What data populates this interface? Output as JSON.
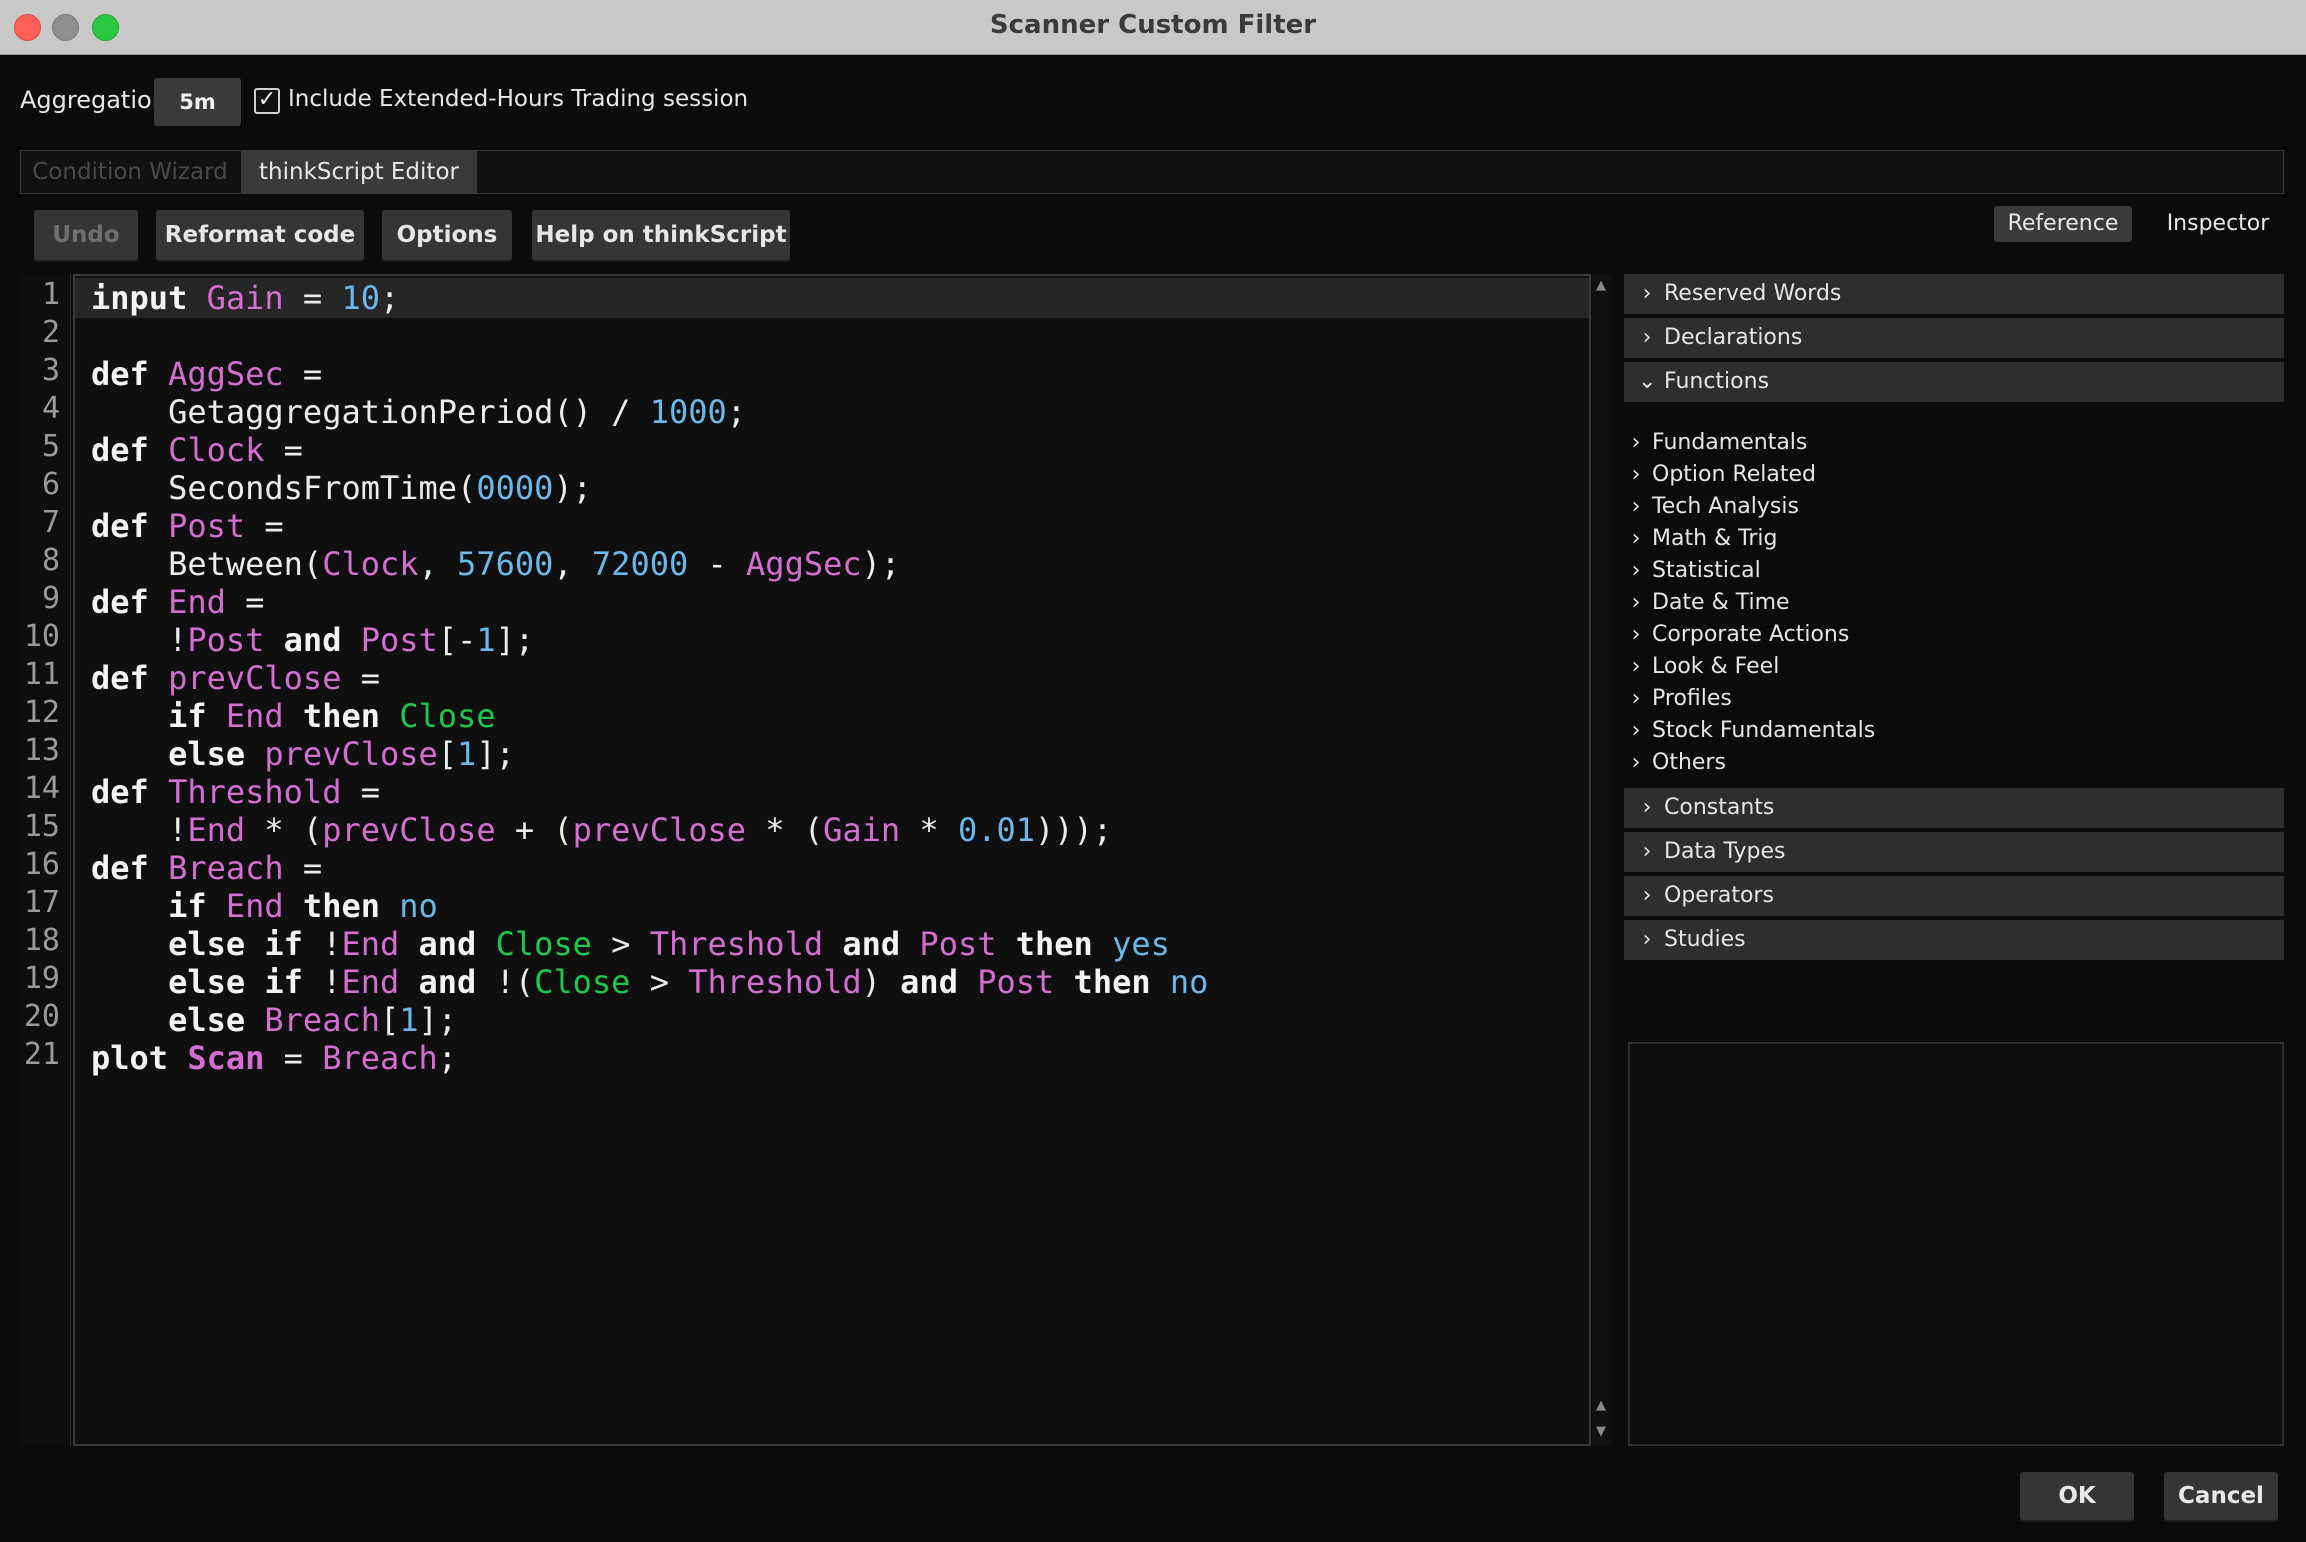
{
  "window": {
    "title": "Scanner Custom Filter"
  },
  "aggregation": {
    "label": "Aggregation:",
    "value": "5m"
  },
  "extended_hours": {
    "label": "Include Extended-Hours Trading session",
    "checked": true,
    "check_glyph": "✓"
  },
  "tabs": [
    {
      "label": "Condition Wizard",
      "active": false
    },
    {
      "label": "thinkScript Editor",
      "active": true
    }
  ],
  "toolbar": {
    "undo_label": "Undo",
    "reformat_label": "Reformat code",
    "options_label": "Options",
    "help_label": "Help on thinkScript"
  },
  "side_tabs": {
    "reference": "Reference",
    "inspector": "Inspector"
  },
  "line_numbers": [
    "1",
    "2",
    "3",
    "4",
    "5",
    "6",
    "7",
    "8",
    "9",
    "10",
    "11",
    "12",
    "13",
    "14",
    "15",
    "16",
    "17",
    "18",
    "19",
    "20",
    "21"
  ],
  "code_lines": [
    [
      {
        "t": "input",
        "c": "kw"
      },
      {
        "t": " "
      },
      {
        "t": "Gain",
        "c": "v"
      },
      {
        "t": " = "
      },
      {
        "t": "10",
        "c": "n"
      },
      {
        "t": ";"
      }
    ],
    [],
    [
      {
        "t": "def",
        "c": "kw"
      },
      {
        "t": " "
      },
      {
        "t": "AggSec",
        "c": "v"
      },
      {
        "t": " ="
      }
    ],
    [
      {
        "t": "    GetaggregationPeriod() / "
      },
      {
        "t": "1000",
        "c": "n"
      },
      {
        "t": ";"
      }
    ],
    [
      {
        "t": "def",
        "c": "kw"
      },
      {
        "t": " "
      },
      {
        "t": "Clock",
        "c": "v"
      },
      {
        "t": " ="
      }
    ],
    [
      {
        "t": "    SecondsFromTime("
      },
      {
        "t": "0000",
        "c": "n"
      },
      {
        "t": ");"
      }
    ],
    [
      {
        "t": "def",
        "c": "kw"
      },
      {
        "t": " "
      },
      {
        "t": "Post",
        "c": "v"
      },
      {
        "t": " ="
      }
    ],
    [
      {
        "t": "    Between("
      },
      {
        "t": "Clock",
        "c": "v"
      },
      {
        "t": ", "
      },
      {
        "t": "57600",
        "c": "n"
      },
      {
        "t": ", "
      },
      {
        "t": "72000",
        "c": "n"
      },
      {
        "t": " - "
      },
      {
        "t": "AggSec",
        "c": "v"
      },
      {
        "t": ");"
      }
    ],
    [
      {
        "t": "def",
        "c": "kw"
      },
      {
        "t": " "
      },
      {
        "t": "End",
        "c": "v"
      },
      {
        "t": " ="
      }
    ],
    [
      {
        "t": "    !"
      },
      {
        "t": "Post",
        "c": "v"
      },
      {
        "t": " "
      },
      {
        "t": "and",
        "c": "kw"
      },
      {
        "t": " "
      },
      {
        "t": "Post",
        "c": "v"
      },
      {
        "t": "[-"
      },
      {
        "t": "1",
        "c": "n"
      },
      {
        "t": "];"
      }
    ],
    [
      {
        "t": "def",
        "c": "kw"
      },
      {
        "t": " "
      },
      {
        "t": "prevClose",
        "c": "v"
      },
      {
        "t": " ="
      }
    ],
    [
      {
        "t": "    "
      },
      {
        "t": "if",
        "c": "kw"
      },
      {
        "t": " "
      },
      {
        "t": "End",
        "c": "v"
      },
      {
        "t": " "
      },
      {
        "t": "then",
        "c": "kw"
      },
      {
        "t": " "
      },
      {
        "t": "Close",
        "c": "g"
      }
    ],
    [
      {
        "t": "    "
      },
      {
        "t": "else",
        "c": "kw"
      },
      {
        "t": " "
      },
      {
        "t": "prevClose",
        "c": "v"
      },
      {
        "t": "["
      },
      {
        "t": "1",
        "c": "n"
      },
      {
        "t": "];"
      }
    ],
    [
      {
        "t": "def",
        "c": "kw"
      },
      {
        "t": " "
      },
      {
        "t": "Threshold",
        "c": "v"
      },
      {
        "t": " ="
      }
    ],
    [
      {
        "t": "    !"
      },
      {
        "t": "End",
        "c": "v"
      },
      {
        "t": " * ("
      },
      {
        "t": "prevClose",
        "c": "v"
      },
      {
        "t": " + ("
      },
      {
        "t": "prevClose",
        "c": "v"
      },
      {
        "t": " * ("
      },
      {
        "t": "Gain",
        "c": "v"
      },
      {
        "t": " * "
      },
      {
        "t": "0.01",
        "c": "n"
      },
      {
        "t": ")));"
      }
    ],
    [
      {
        "t": "def",
        "c": "kw"
      },
      {
        "t": " "
      },
      {
        "t": "Breach",
        "c": "v"
      },
      {
        "t": " ="
      }
    ],
    [
      {
        "t": "    "
      },
      {
        "t": "if",
        "c": "kw"
      },
      {
        "t": " "
      },
      {
        "t": "End",
        "c": "v"
      },
      {
        "t": " "
      },
      {
        "t": "then",
        "c": "kw"
      },
      {
        "t": " "
      },
      {
        "t": "no",
        "c": "n"
      }
    ],
    [
      {
        "t": "    "
      },
      {
        "t": "else",
        "c": "kw"
      },
      {
        "t": " "
      },
      {
        "t": "if",
        "c": "kw"
      },
      {
        "t": " !"
      },
      {
        "t": "End",
        "c": "v"
      },
      {
        "t": " "
      },
      {
        "t": "and",
        "c": "kw"
      },
      {
        "t": " "
      },
      {
        "t": "Close",
        "c": "g"
      },
      {
        "t": " > "
      },
      {
        "t": "Threshold",
        "c": "v"
      },
      {
        "t": " "
      },
      {
        "t": "and",
        "c": "kw"
      },
      {
        "t": " "
      },
      {
        "t": "Post",
        "c": "v"
      },
      {
        "t": " "
      },
      {
        "t": "then",
        "c": "kw"
      },
      {
        "t": " "
      },
      {
        "t": "yes",
        "c": "n"
      }
    ],
    [
      {
        "t": "    "
      },
      {
        "t": "else",
        "c": "kw"
      },
      {
        "t": " "
      },
      {
        "t": "if",
        "c": "kw"
      },
      {
        "t": " !"
      },
      {
        "t": "End",
        "c": "v"
      },
      {
        "t": " "
      },
      {
        "t": "and",
        "c": "kw"
      },
      {
        "t": " !("
      },
      {
        "t": "Close",
        "c": "g"
      },
      {
        "t": " > "
      },
      {
        "t": "Threshold",
        "c": "v"
      },
      {
        "t": ") "
      },
      {
        "t": "and",
        "c": "kw"
      },
      {
        "t": " "
      },
      {
        "t": "Post",
        "c": "v"
      },
      {
        "t": " "
      },
      {
        "t": "then",
        "c": "kw"
      },
      {
        "t": " "
      },
      {
        "t": "no",
        "c": "n"
      }
    ],
    [
      {
        "t": "    "
      },
      {
        "t": "else",
        "c": "kw"
      },
      {
        "t": " "
      },
      {
        "t": "Breach",
        "c": "v"
      },
      {
        "t": "["
      },
      {
        "t": "1",
        "c": "n"
      },
      {
        "t": "];"
      }
    ],
    [
      {
        "t": "plot",
        "c": "kw"
      },
      {
        "t": " "
      },
      {
        "t": "Scan",
        "c": "v kw"
      },
      {
        "t": " = "
      },
      {
        "t": "Breach",
        "c": "v"
      },
      {
        "t": ";"
      }
    ]
  ],
  "reference_tree": {
    "categories_top": [
      {
        "label": "Reserved Words",
        "expanded": false
      },
      {
        "label": "Declarations",
        "expanded": false
      },
      {
        "label": "Functions",
        "expanded": true
      }
    ],
    "function_items": [
      "Fundamentals",
      "Option Related",
      "Tech Analysis",
      "Math & Trig",
      "Statistical",
      "Date & Time",
      "Corporate Actions",
      "Look & Feel",
      "Profiles",
      "Stock Fundamentals",
      "Others"
    ],
    "categories_bottom": [
      {
        "label": "Constants",
        "expanded": false
      },
      {
        "label": "Data Types",
        "expanded": false
      },
      {
        "label": "Operators",
        "expanded": false
      },
      {
        "label": "Studies",
        "expanded": false
      }
    ]
  },
  "footer": {
    "ok_label": "OK",
    "cancel_label": "Cancel"
  },
  "colors": {
    "variable": "#d46ed2",
    "number": "#6cb8ea",
    "builtin": "#1ec84c",
    "keyword": "#f4f4f4",
    "background": "#0b0b0b"
  }
}
